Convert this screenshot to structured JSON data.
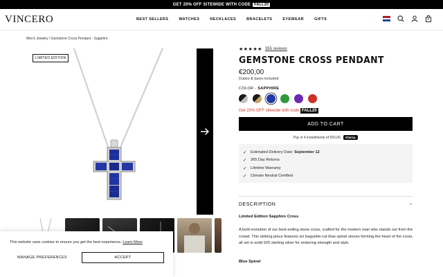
{
  "promo_bar": {
    "text": "GET 20% OFF SITEWIDE WITH CODE",
    "code": "FALL20"
  },
  "header": {
    "logo": "VINCERO",
    "nav": [
      "BEST SELLERS",
      "WATCHES",
      "NECKLACES",
      "BRACELETS",
      "EYEWEAR",
      "GIFTS"
    ],
    "icons": [
      "netherlands-flag-icon",
      "search-icon",
      "account-icon",
      "cart-icon"
    ],
    "cart_count": "0"
  },
  "breadcrumb": "Men's Jewelry / Gemstone Cross Pendant - Sapphire",
  "gallery": {
    "badge": "LIMITED EDITION",
    "next_icon": "arrow-right-icon"
  },
  "product": {
    "rating_stars": "★★★★★",
    "reviews": "355 reviews",
    "title": "GEMSTONE CROSS PENDANT",
    "price": "€200,00",
    "duties": "Duties & taxes included",
    "color_label": "COLOR - ",
    "color_value": "SAPPHIRE",
    "swatches": [
      {
        "name": "black-onyx",
        "color": "#1a1a1a"
      },
      {
        "name": "tiger-eye",
        "color": "#c9a46a"
      },
      {
        "name": "sapphire",
        "color": "#1f3aa8",
        "selected": true
      },
      {
        "name": "emerald",
        "color": "#2e9a3b"
      },
      {
        "name": "amethyst",
        "color": "#6a2bb0"
      },
      {
        "name": "ruby",
        "color": "#d0302a"
      }
    ],
    "promo_text": "Get 20% OFF sitewide with code",
    "promo_code": "FALL20",
    "add_to_cart": "ADD TO CART",
    "installments": "Pay in 4 installments of €50,00.",
    "klarna": "Klarna.",
    "benefits": [
      {
        "text": "Estimated Delivery Date: ",
        "bold": "September 12"
      },
      {
        "text": "365 Day Returns",
        "bold": ""
      },
      {
        "text": "Lifetime Warranty",
        "bold": ""
      },
      {
        "text": "Climate Neutral Certified",
        "bold": ""
      }
    ],
    "description_heading": "DESCRIPTION",
    "description_toggle": "−",
    "description_subtitle": "Limited Edition Sapphire Cross",
    "description_body": "A bold evolution of our best-selling stone cross, crafted for the modern man who stands out from the crowd. This striking piece features six baguette-cut blue spinel stones forming the heart of the cross, all set in solid 925 sterling silver for enduring strength and style.",
    "description_subtitle2": "Blue Spinel"
  },
  "cookie": {
    "text": "This website uses cookies to ensure you get the best experience.",
    "link": "Learn More",
    "manage": "MANAGE PREFERENCES",
    "accept": "ACCEPT"
  },
  "colors": {
    "accent": "#000000",
    "promo_red": "#d23b2a",
    "sapphire": "#1f3aa8"
  }
}
